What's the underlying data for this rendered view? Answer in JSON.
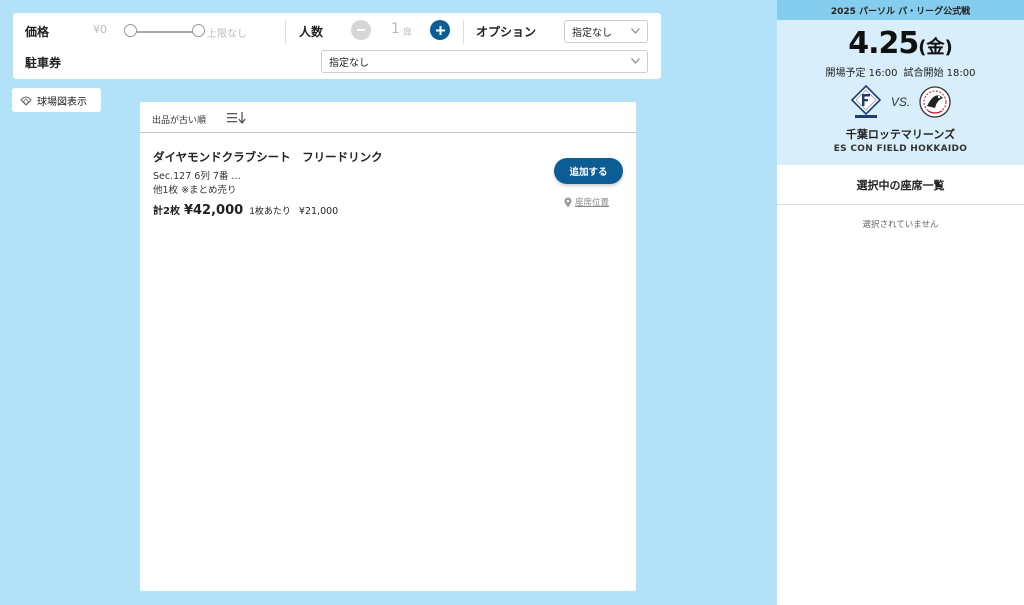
{
  "filters": {
    "price_label": "価格",
    "price_min": "¥0",
    "price_max": "上限なし",
    "people_label": "人数",
    "people_value": "1",
    "people_unit": "席",
    "option_label": "オプション",
    "option_value": "指定なし",
    "parking_label": "駐車券",
    "parking_value": "指定なし"
  },
  "map_button": {
    "label": "球場図表示",
    "icon": "stadium-icon"
  },
  "sort": {
    "label": "出品が古い順",
    "icon": "sort-icon"
  },
  "listings": [
    {
      "title": "ダイヤモンドクラブシート　フリードリンク",
      "section": "Sec.127 6列 7番 …",
      "extra": "他1枚 ※まとめ売り",
      "count": "計2枚",
      "total": "¥42,000",
      "per_label": "1枚あたり",
      "per_price": "¥21,000",
      "add_label": "追加する",
      "seat_location_label": "座席位置"
    }
  ],
  "event": {
    "header": "2025 パーソル パ・リーグ公式戦",
    "date": "4.25",
    "weekday": "(金)",
    "open_time": "開場予定 16:00",
    "start_time": "試合開始 18:00",
    "vs": "VS.",
    "home_team_logo": "fighters-logo",
    "away_team_logo": "marines-logo",
    "opponent": "千葉ロッテマリーンズ",
    "venue": "ES CON FIELD HOKKAIDO"
  },
  "selection": {
    "title": "選択中の座席一覧",
    "empty": "選択されていません"
  },
  "colors": {
    "background": "#b3e1f7",
    "accent": "#0c5d95",
    "event_header": "#85cdef",
    "event_card": "#d8eefb"
  }
}
